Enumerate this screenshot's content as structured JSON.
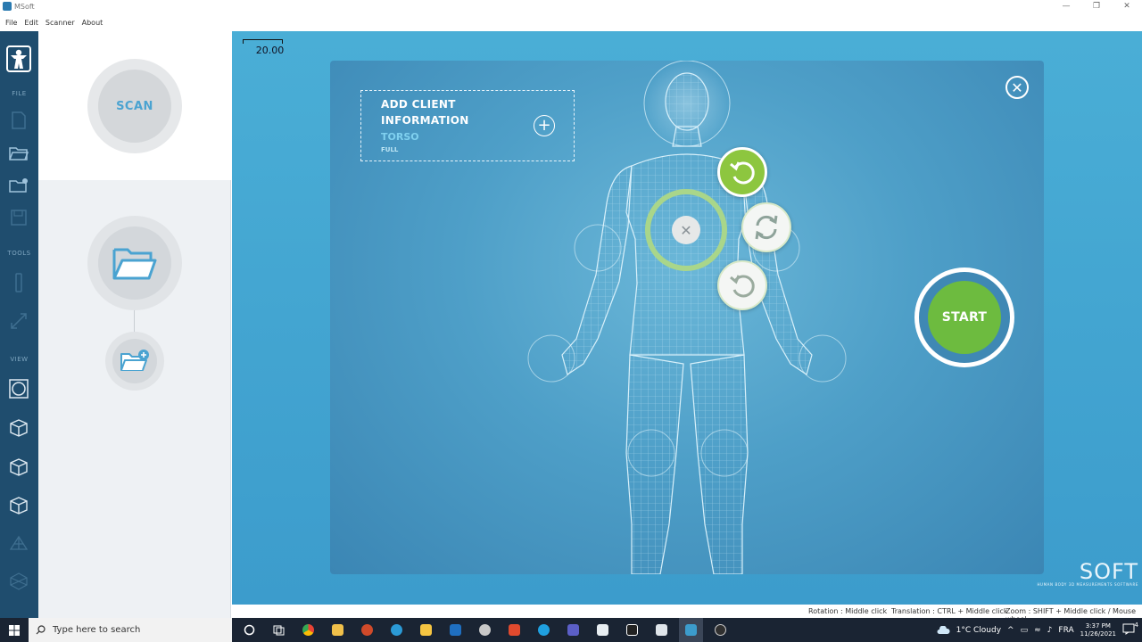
{
  "window": {
    "title": "MSoft",
    "minimize": "—",
    "maximize": "❐",
    "close": "✕"
  },
  "menu": [
    "File",
    "Edit",
    "Scanner",
    "About"
  ],
  "leftbar": {
    "sections": {
      "file": "FILE",
      "tools": "TOOLS",
      "view": "VIEW"
    }
  },
  "panel": {
    "scan_label": "SCAN"
  },
  "viewport": {
    "scale_value": "20.00",
    "client_box": {
      "title_line1": "ADD CLIENT",
      "title_line2": "INFORMATION",
      "mode_selected": "TORSO",
      "mode_other": "FULL",
      "add_symbol": "+"
    },
    "close_symbol": "✕",
    "focus_close_symbol": "✕",
    "start_label": "START",
    "brand": {
      "name": "SOFT",
      "tagline": "HUMAN BODY 3D MEASUREMENTS SOFTWARE"
    }
  },
  "statusbar": {
    "rotation": "Rotation : Middle click",
    "translation": "Translation : CTRL + Middle click",
    "zoom": "Zoom : SHIFT + Middle click / Mouse wheel"
  },
  "taskbar": {
    "search_placeholder": "Type here to search",
    "weather": "1°C  Cloudy",
    "language": "FRA",
    "time": "3:37 PM",
    "date": "11/26/2021",
    "notification_count": "4",
    "apps": [
      "task-view-icon",
      "chrome-icon",
      "store-icon",
      "powerpoint-icon",
      "edge-icon",
      "file-explorer-icon",
      "outlook-icon",
      "app-icon",
      "acrobat-icon",
      "skype-icon",
      "teams-icon",
      "notepad-icon",
      "inkscape-icon",
      "window-icon",
      "msoft-icon",
      "obs-icon"
    ]
  },
  "colors": {
    "accent_green": "#6dbb3f",
    "accent_blue": "#4aa3d1",
    "sidebar": "#1f4d6e"
  }
}
